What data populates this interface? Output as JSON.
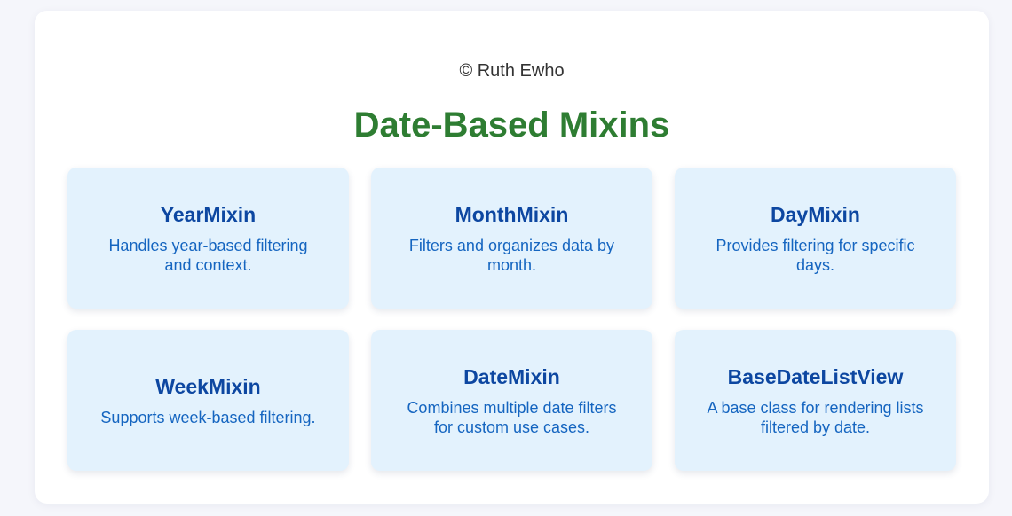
{
  "header": {
    "copyright": "© Ruth Ewho",
    "title": "Date-Based Mixins"
  },
  "cards": [
    {
      "title": "YearMixin",
      "description": "Handles year-based filtering and context."
    },
    {
      "title": "MonthMixin",
      "description": "Filters and organizes data by month."
    },
    {
      "title": "DayMixin",
      "description": "Provides filtering for specific days."
    },
    {
      "title": "WeekMixin",
      "description": "Supports week-based filtering."
    },
    {
      "title": "DateMixin",
      "description": "Combines multiple date filters for custom use cases."
    },
    {
      "title": "BaseDateListView",
      "description": "A base class for rendering lists filtered by date."
    }
  ],
  "colors": {
    "title_green": "#2e7d32",
    "card_background": "#e3f2fd",
    "card_title": "#0d47a1",
    "card_text": "#1565c0"
  }
}
